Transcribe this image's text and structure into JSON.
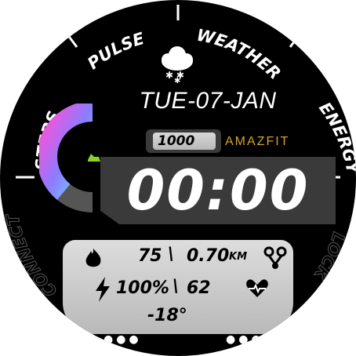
{
  "face": {
    "labels": {
      "pulse": "PULSE",
      "weather": "WEATHER",
      "energy": "ENERGY",
      "steps": "STEPS",
      "connect": "CONNECT",
      "lock": "LOCK"
    },
    "date": "TUE-07-JAN",
    "step_goal": "1000",
    "brand": "AMAZFIT",
    "time": "00:00",
    "calories": "75",
    "distance": "0.70",
    "distance_unit": "KM",
    "battery": "100%",
    "heart_rate": "62",
    "temperature": "-18°",
    "icons": {
      "weather": "snow-cloud-icon",
      "steps": "shoe-icon",
      "calories": "flame-icon",
      "battery": "lightning-icon",
      "distance": "route-icon",
      "heart": "heart-pulse-icon",
      "dots": "dots-icon"
    },
    "colors": {
      "accent_gold": "#d4a32c",
      "gauge_start": "#6cf7ff",
      "gauge_end": "#ff4fd8",
      "panel_gray": "#3a3a3a"
    },
    "step_progress": 0.78
  }
}
